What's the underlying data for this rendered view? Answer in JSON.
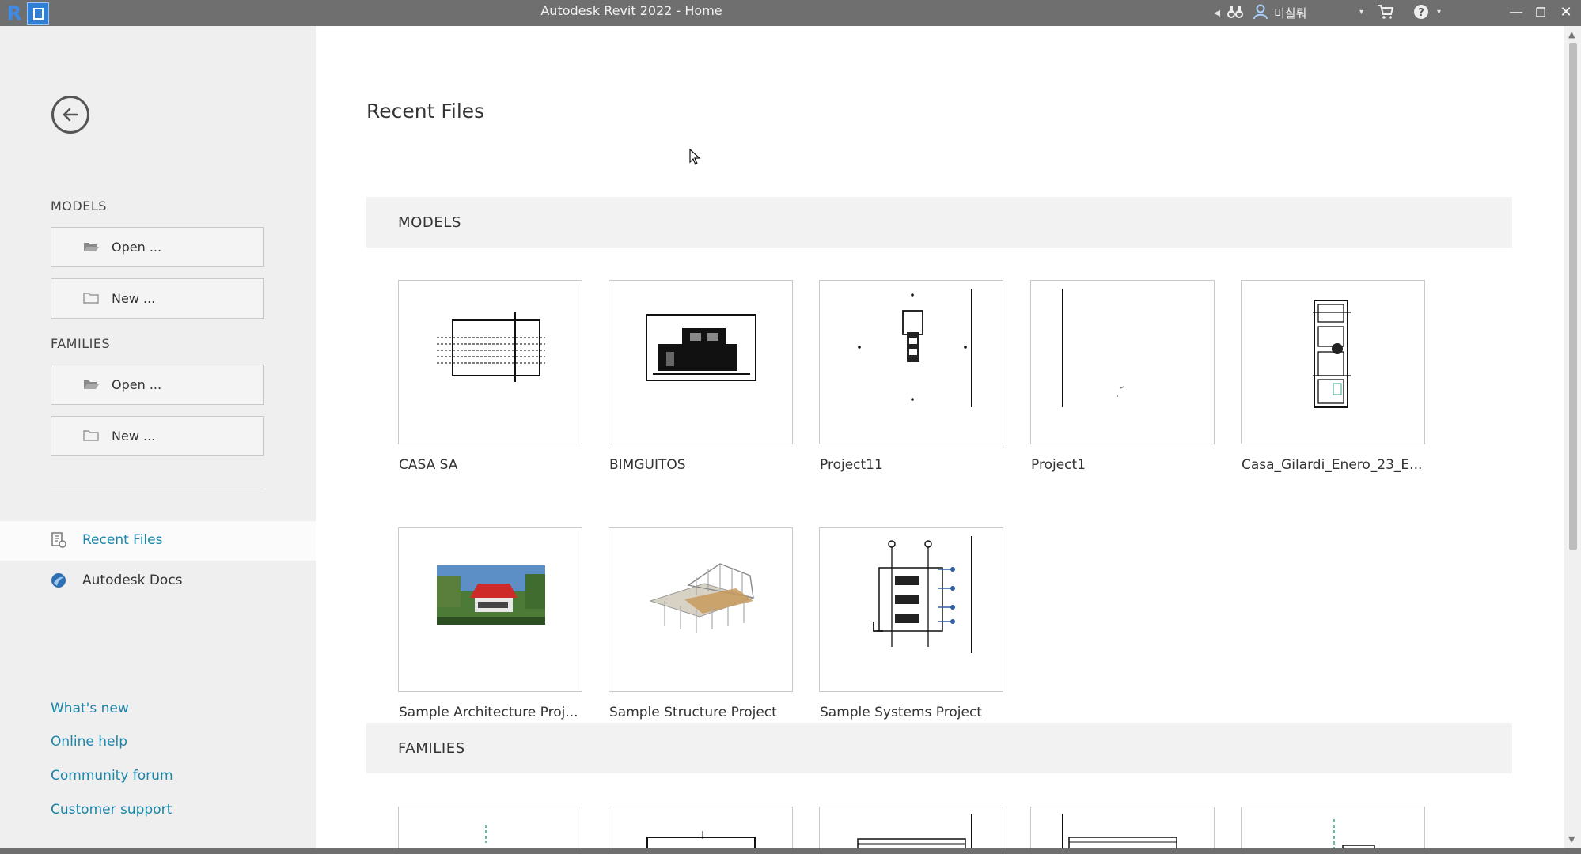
{
  "window": {
    "title": "Autodesk Revit 2022 - Home",
    "user": "미칠뤄"
  },
  "sidebar": {
    "models_heading": "MODELS",
    "models_open": "Open ...",
    "models_new": "New ...",
    "families_heading": "FAMILIES",
    "families_open": "Open ...",
    "families_new": "New ...",
    "nav": [
      {
        "label": "Recent Files",
        "active": true
      },
      {
        "label": "Autodesk Docs",
        "active": false
      }
    ],
    "links": [
      "What's new",
      "Online help",
      "Community forum",
      "Customer support"
    ]
  },
  "main": {
    "title": "Recent Files",
    "models_section": "MODELS",
    "families_section": "FAMILIES",
    "models": [
      {
        "name": "CASA SA"
      },
      {
        "name": "BIMGUITOS"
      },
      {
        "name": "Project11"
      },
      {
        "name": "Project1"
      },
      {
        "name": "Casa_Gilardi_Enero_23_E..."
      },
      {
        "name": "Sample Architecture Proj..."
      },
      {
        "name": "Sample Structure Project"
      },
      {
        "name": "Sample Systems Project"
      }
    ]
  },
  "colors": {
    "accent": "#1a86a8",
    "titlebar": "#6f6f6f",
    "sidebar": "#efefef"
  }
}
